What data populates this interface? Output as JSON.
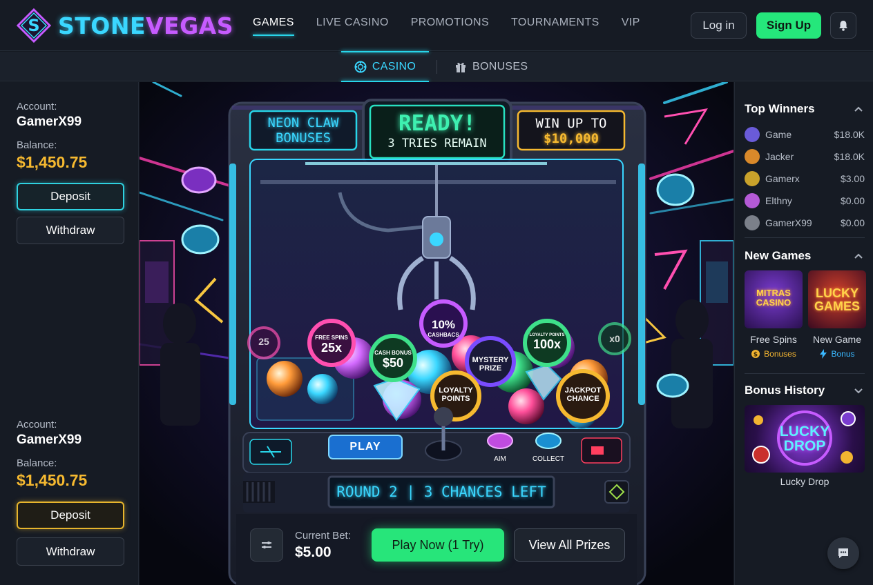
{
  "brand": {
    "part1": "STONE",
    "part2": "VEGAS"
  },
  "nav": [
    "GAMES",
    "LIVE CASINO",
    "PROMOTIONS",
    "TOURNAMENTS",
    "VIP"
  ],
  "auth": {
    "login": "Log in",
    "signup": "Sign Up"
  },
  "subnav": {
    "casino": "CASINO",
    "bonuses": "BONUSES"
  },
  "left": {
    "account_label": "Account:",
    "username": "GamerX99",
    "balance_label": "Balance:",
    "balance": "$1,450.75",
    "deposit": "Deposit",
    "withdraw": "Withdraw"
  },
  "game": {
    "sign_left_line1": "NEON CLAW",
    "sign_left_line2": "BONUSES",
    "sign_center_line1": "READY!",
    "sign_center_line2": "3 TRIES REMAIN",
    "sign_right_line1": "WIN UP TO",
    "sign_right_line2": "$10,000",
    "chips": {
      "free_spins_top": "FREE SPINS",
      "free_spins_val": "25x",
      "cashback_val": "10%",
      "cashback_label": "CASHBACS",
      "cash_bonus_top": "CASH BONUS",
      "cash_bonus_val": "$50",
      "mystery_line1": "MYSTERY",
      "mystery_line2": "PRIZE",
      "loyalty_line1": "LOYALTY",
      "loyalty_line2": "POINTS",
      "jackpot_line1": "JACKPOT",
      "jackpot_line2": "CHANCE",
      "x100_top": "LOYALTY POINTS",
      "x100_val": "100x",
      "left_partial": "25",
      "right_partial": "x0"
    },
    "play_button": "PLAY",
    "aim_label": "AIM",
    "collect_label": "COLLECT",
    "round_display": "ROUND 2 | 3 CHANCES LEFT"
  },
  "controls": {
    "current_bet_label": "Current Bet:",
    "current_bet": "$5.00",
    "play_now": "Play Now (1 Try)",
    "view_all": "View All Prizes"
  },
  "right": {
    "top_winners_title": "Top Winners",
    "winners": [
      {
        "name": "Game",
        "amount": "$18.0K",
        "color": "#6a5bd8"
      },
      {
        "name": "Jacker",
        "amount": "$18.0K",
        "color": "#d9892a"
      },
      {
        "name": "Gamerx",
        "amount": "$3.00",
        "color": "#c9a22b"
      },
      {
        "name": "Elthny",
        "amount": "$0.00",
        "color": "#b45ad6"
      },
      {
        "name": "GamerX99",
        "amount": "$0.00",
        "color": "#7b808a"
      }
    ],
    "new_games_title": "New Games",
    "games": [
      {
        "thumb_line1": "MITRAS",
        "thumb_line2": "CASINO",
        "name": "Free Spins",
        "tag": "Bonuses",
        "tag_color": "#f2b431"
      },
      {
        "thumb_line1": "LUCKY",
        "thumb_line2": "GAMES",
        "name": "New Game",
        "tag": "Bonus",
        "tag_color": "#3ab8ff"
      }
    ],
    "bonus_history_title": "Bonus History",
    "bonus_thumb_line1": "LUCKY",
    "bonus_thumb_line2": "DROP",
    "bonus_name": "Lucky Drop"
  },
  "colors": {
    "accent_cyan": "#28d6ea",
    "accent_green": "#25e77b",
    "gold": "#f6b930",
    "purple": "#c65bff"
  }
}
